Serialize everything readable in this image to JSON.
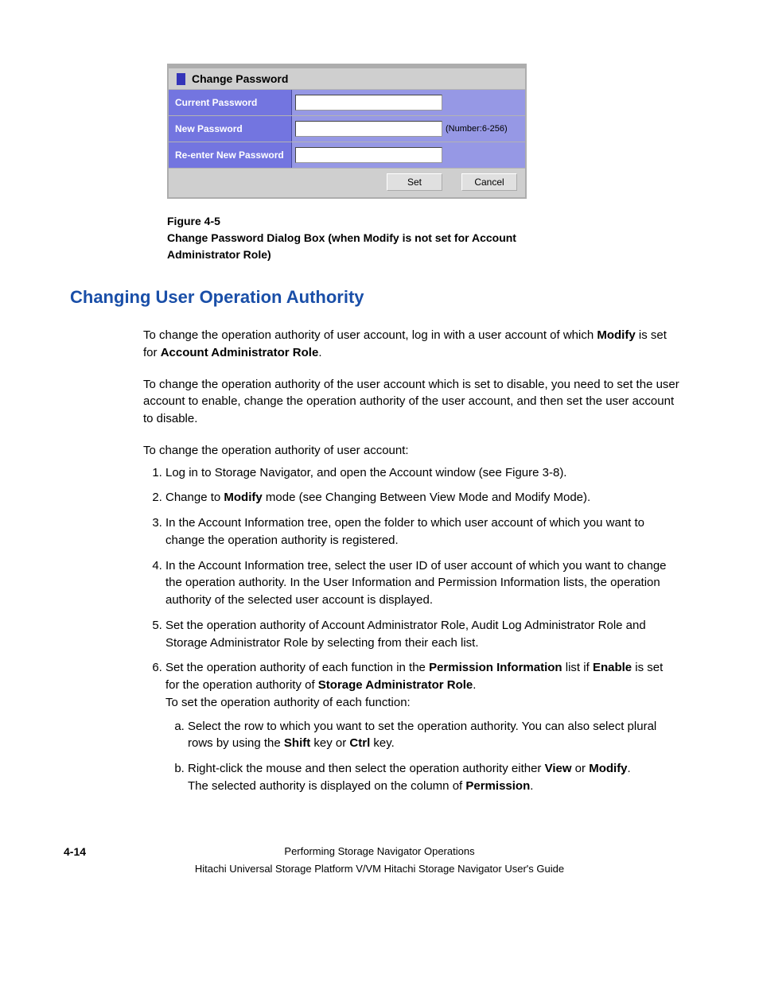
{
  "dialog": {
    "title": "Change Password",
    "rows": {
      "current": {
        "label": "Current Password"
      },
      "new": {
        "label": "New Password",
        "hint": "(Number:6-256)"
      },
      "reenter": {
        "label": "Re-enter New Password"
      }
    },
    "buttons": {
      "set": "Set",
      "cancel": "Cancel"
    }
  },
  "figure": {
    "number": "Figure 4-5",
    "caption": "Change Password Dialog Box (when Modify is not set for Account Administrator Role)"
  },
  "section_heading": "Changing User Operation Authority",
  "para1_a": "To change the operation authority of user account, log in with a user account of which ",
  "para1_b": "Modify",
  "para1_c": " is set for ",
  "para1_d": "Account Administrator Role",
  "para1_e": ".",
  "para2": "To change the operation authority of the user account which is set to disable, you need to set the user account to enable, change the operation authority of the user account, and then set the user account to disable.",
  "para3": "To change the operation authority of user account:",
  "steps": {
    "s1": "Log in to Storage Navigator, and open the Account window (see Figure 3-8).",
    "s2_a": "Change to ",
    "s2_b": "Modify",
    "s2_c": " mode (see Changing Between View Mode and Modify Mode).",
    "s3": "In the Account Information tree, open the folder to which user account of which you want to change the operation authority is registered.",
    "s4": "In the Account Information tree, select the user ID of user account of which you want to change the operation authority. In the User Information and Permission Information lists, the operation authority of the selected user account is displayed.",
    "s5": "Set the operation authority of Account Administrator Role, Audit Log Administrator Role and Storage Administrator Role by selecting from their each list.",
    "s6_a": "Set the operation authority of each function in the ",
    "s6_b": "Permission Information",
    "s6_c": " list if ",
    "s6_d": "Enable",
    "s6_e": " is set for the operation authority of ",
    "s6_f": "Storage Administrator Role",
    "s6_g": ".",
    "s6_post": "To set the operation authority of each function:",
    "s6a_a": "Select the row to which you want to set the operation authority. You can also select plural rows by using the ",
    "s6a_b": "Shift",
    "s6a_c": " key or ",
    "s6a_d": "Ctrl",
    "s6a_e": " key.",
    "s6b_a": "Right-click the mouse and then select the operation authority either ",
    "s6b_b": "View",
    "s6b_c": " or ",
    "s6b_d": "Modify",
    "s6b_e": ".",
    "s6b_post_a": "The selected authority is displayed on the column of ",
    "s6b_post_b": "Permission",
    "s6b_post_c": "."
  },
  "footer": {
    "page_num": "4-14",
    "line1": "Performing Storage Navigator Operations",
    "line2": "Hitachi Universal Storage Platform V/VM Hitachi Storage Navigator User's Guide"
  }
}
